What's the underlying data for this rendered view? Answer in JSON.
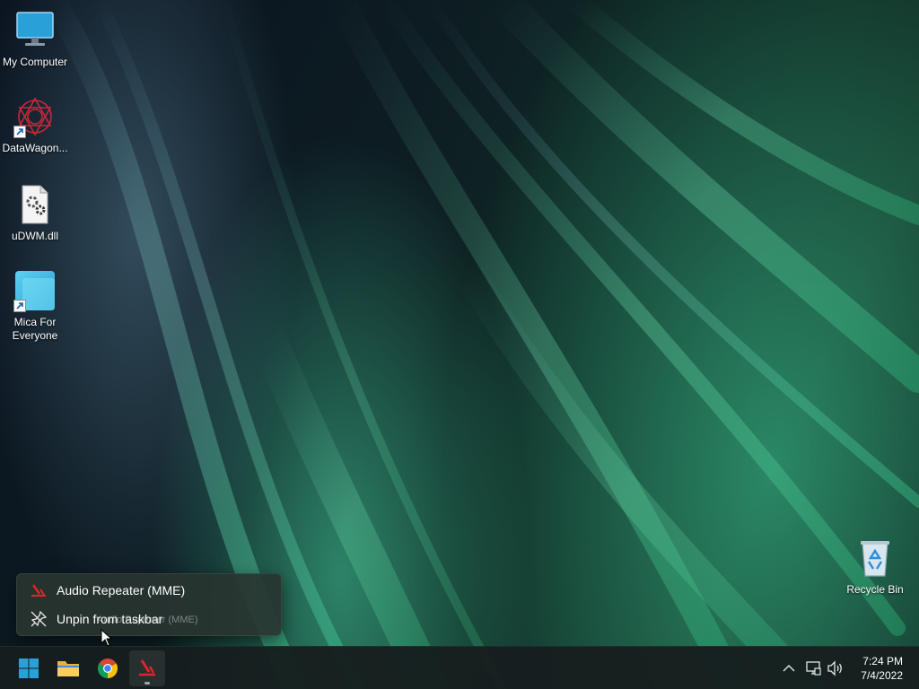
{
  "desktop": {
    "icons": [
      {
        "label": "My Computer"
      },
      {
        "label": "DataWagon..."
      },
      {
        "label": "uDWM.dll"
      },
      {
        "label": "Mica For\nEveryone"
      },
      {
        "label": "Recycle Bin"
      }
    ]
  },
  "jumplist": {
    "items": [
      {
        "label": "Audio Repeater (MME)",
        "icon": "audio-repeater-icon"
      },
      {
        "label": "Unpin from taskbar",
        "icon": "unpin-icon"
      }
    ]
  },
  "tooltip": {
    "text": "Audio Repeater (MME)"
  },
  "taskbar": {
    "apps": [
      {
        "name": "start",
        "icon": "windows-logo-icon"
      },
      {
        "name": "file-explorer",
        "icon": "folder-icon"
      },
      {
        "name": "chrome",
        "icon": "chrome-icon"
      },
      {
        "name": "audio-repeater",
        "icon": "audio-repeater-icon"
      }
    ],
    "tray": {
      "icons": [
        "chevron-up-icon",
        "network-icon",
        "volume-icon"
      ]
    },
    "clock": {
      "time": "7:24 PM",
      "date": "7/4/2022"
    }
  },
  "colors": {
    "accent": "#2aa0d8",
    "audio_red": "#e0252a"
  }
}
